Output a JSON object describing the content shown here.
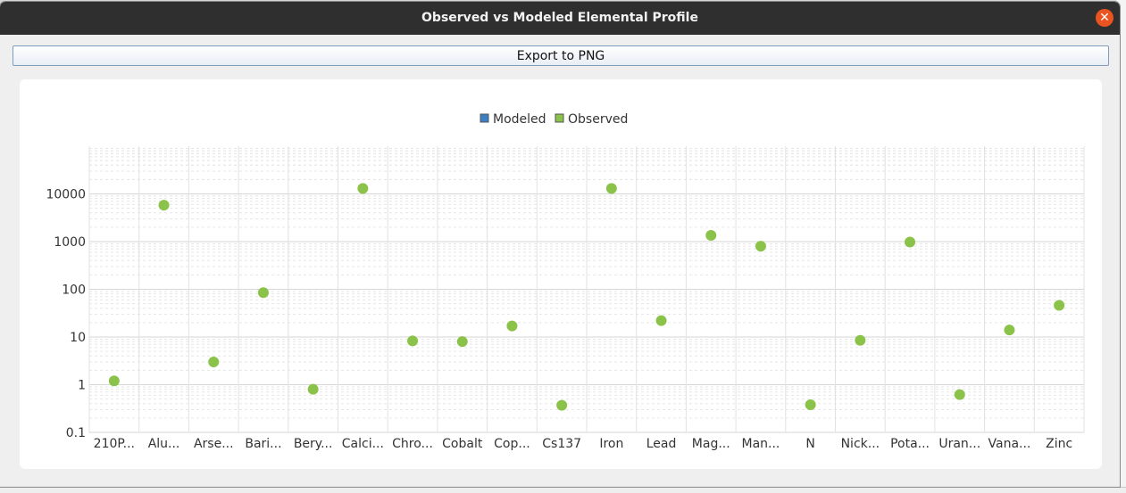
{
  "window": {
    "title": "Observed vs Modeled Elemental Profile",
    "close_icon": "close-icon",
    "close_glyph": "✕"
  },
  "toolbar": {
    "export_label": "Export to PNG"
  },
  "colors": {
    "modeled": "#3b7fc4",
    "observed": "#8bc34a",
    "close": "#e95420"
  },
  "chart_data": {
    "type": "scatter",
    "yscale": "log",
    "ylim": [
      0.1,
      100000
    ],
    "grid": true,
    "legend": {
      "position": "top",
      "entries": [
        "Modeled",
        "Observed"
      ]
    },
    "y_tick_labels": [
      "0.1",
      "1",
      "10",
      "100",
      "1000",
      "10000"
    ],
    "categories": [
      "210P...",
      "Alu...",
      "Arse...",
      "Bari...",
      "Bery...",
      "Calci...",
      "Chro...",
      "Cobalt",
      "Cop...",
      "Cs137",
      "Iron",
      "Lead",
      "Mag...",
      "Man...",
      "N",
      "Nick...",
      "Pota...",
      "Uran...",
      "Vana...",
      "Zinc"
    ],
    "series": [
      {
        "name": "Modeled",
        "values": []
      },
      {
        "name": "Observed",
        "values": [
          1.2,
          5800,
          3.0,
          85,
          0.8,
          13000,
          8.3,
          8.0,
          17,
          0.37,
          13000,
          22,
          1350,
          800,
          0.38,
          8.5,
          980,
          0.62,
          14,
          46
        ]
      }
    ]
  }
}
